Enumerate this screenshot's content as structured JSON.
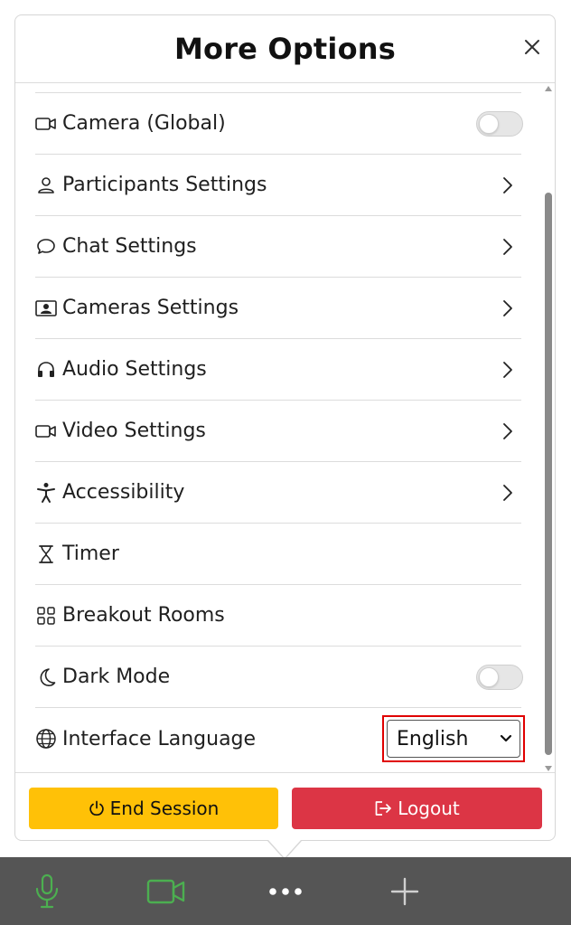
{
  "panel": {
    "title": "More Options"
  },
  "items": [
    {
      "label": "Camera (Global)",
      "icon": "video-camera-icon",
      "control": "toggle",
      "on": false
    },
    {
      "label": "Participants Settings",
      "icon": "person-icon",
      "control": "chevron"
    },
    {
      "label": "Chat Settings",
      "icon": "chat-bubble-icon",
      "control": "chevron"
    },
    {
      "label": "Cameras Settings",
      "icon": "person-badge-icon",
      "control": "chevron"
    },
    {
      "label": "Audio Settings",
      "icon": "headphones-icon",
      "control": "chevron"
    },
    {
      "label": "Video Settings",
      "icon": "video-camera-icon",
      "control": "chevron"
    },
    {
      "label": "Accessibility",
      "icon": "accessibility-icon",
      "control": "chevron"
    },
    {
      "label": "Timer",
      "icon": "hourglass-icon",
      "control": "none"
    },
    {
      "label": "Breakout Rooms",
      "icon": "grid-icon",
      "control": "none"
    },
    {
      "label": "Dark Mode",
      "icon": "moon-icon",
      "control": "toggle",
      "on": false
    },
    {
      "label": "Interface Language",
      "icon": "globe-icon",
      "control": "select",
      "value": "English"
    }
  ],
  "footer": {
    "end_session_label": "End Session",
    "logout_label": "Logout"
  },
  "toolbar": {
    "items": [
      "microphone-icon",
      "video-camera-icon",
      "more-dots-icon",
      "plus-icon"
    ]
  },
  "colors": {
    "end_session_bg": "#ffc107",
    "logout_bg": "#dc3545",
    "toolbar_bg": "#555555",
    "active_green": "#4caf50",
    "highlight_red": "#e00000"
  }
}
